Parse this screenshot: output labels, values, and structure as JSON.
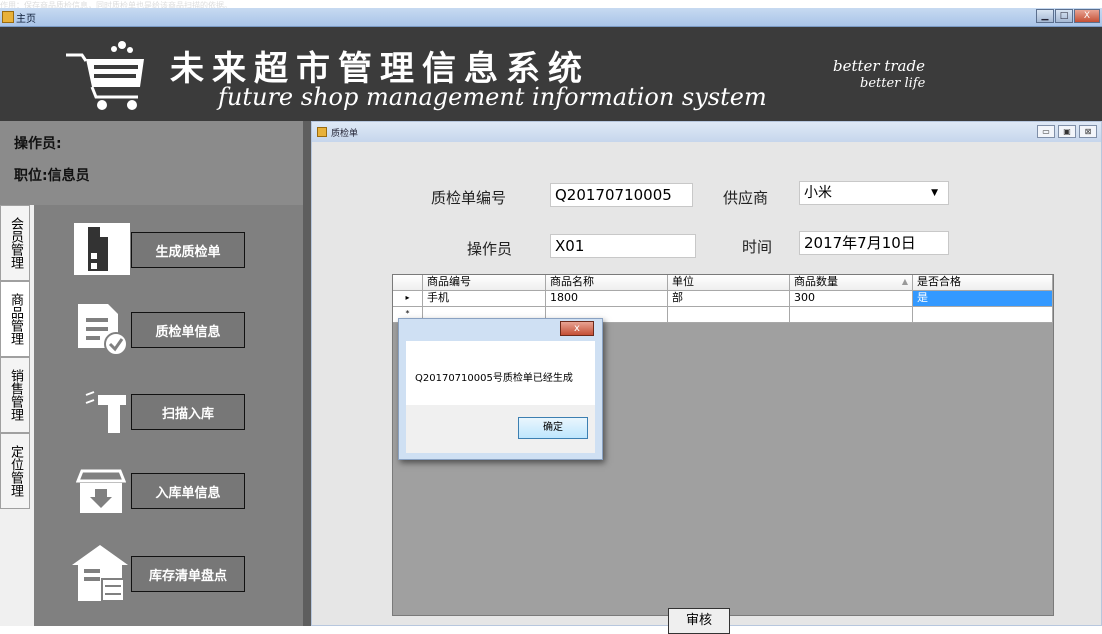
{
  "top_strip_text": "作用：保存商品质检信息，同时质检单也是给该商品扫描的依据。",
  "window": {
    "title": "主页",
    "min": "▁",
    "max": "□",
    "close": "X"
  },
  "header": {
    "title_cn": "未来超市管理信息系统",
    "title_en": "future shop management information system",
    "slogan_line1": "better trade",
    "slogan_line2": "better life"
  },
  "user": {
    "operator": "操作员:",
    "role": "职位:信息员"
  },
  "side_tabs": [
    {
      "label": "会员管理"
    },
    {
      "label": "商品管理"
    },
    {
      "label": "销售管理"
    },
    {
      "label": "定位管理"
    }
  ],
  "menu": [
    {
      "label": "生成质检单",
      "icon": "building-icon"
    },
    {
      "label": "质检单信息",
      "icon": "document-check-icon"
    },
    {
      "label": "扫描入库",
      "icon": "barcode-scanner-icon"
    },
    {
      "label": "入库单信息",
      "icon": "inbox-download-icon"
    },
    {
      "label": "库存清单盘点",
      "icon": "warehouse-abacus-icon"
    }
  ],
  "child_window": {
    "title": "质检单",
    "min": "▭",
    "max": "▣",
    "close": "⊠"
  },
  "form": {
    "qc_no_label": "质检单编号",
    "qc_no_value": "Q20170710005",
    "supplier_label": "供应商",
    "supplier_value": "小米",
    "operator_label": "操作员",
    "operator_value": "X01",
    "time_label": "时间",
    "time_value": "2017年7月10日"
  },
  "grid": {
    "columns": [
      "商品编号",
      "商品名称",
      "单位",
      "商品数量",
      "是否合格"
    ],
    "sort_glyph": "▲",
    "rows": [
      [
        "手机",
        "1800",
        "部",
        "300",
        "是"
      ]
    ],
    "current_row_marker": "▸",
    "new_row_marker": "*"
  },
  "audit_button": "审核",
  "dialog": {
    "message": "Q20170710005号质检单已经生成",
    "ok": "确定",
    "close": "x"
  },
  "colors": {
    "header_bg": "#3b3b3b",
    "panel_bg": "#808080",
    "selection": "#3399ff"
  }
}
